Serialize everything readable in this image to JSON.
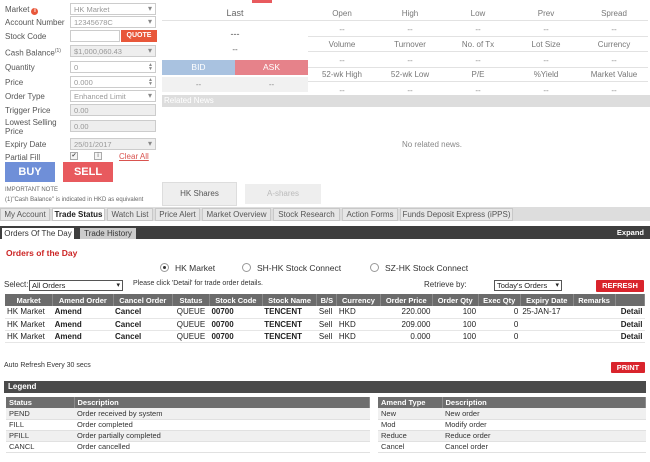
{
  "form": {
    "market_label": "Market",
    "market_value": "HK Market",
    "account_label": "Account Number",
    "account_value": "12345678C",
    "stock_code_label": "Stock Code",
    "stock_code_value": "",
    "quote_button": "QUOTE",
    "cash_label": "Cash Balance",
    "cash_sup": "(1)",
    "cash_value": "$1,000,060.43",
    "quantity_label": "Quantity",
    "quantity_value": "0",
    "price_label": "Price",
    "price_value": "0.000",
    "order_type_label": "Order Type",
    "order_type_value": "Enhanced Limit",
    "trigger_label": "Trigger Price",
    "trigger_value": "0.00",
    "lowest_label": "Lowest Selling Price",
    "lowest_value": "0.00",
    "expiry_label": "Expiry Date",
    "expiry_value": "25/01/2017",
    "partial_label": "Partial Fill",
    "partial_checked": "✔",
    "clear_all": "Clear All",
    "buy": "BUY",
    "sell": "SELL",
    "important_note": "IMPORTANT NOTE",
    "cash_note": "(1)\"Cash Balance\" is indicated in HKD as equivalent"
  },
  "quote": {
    "last_label": "Last",
    "last_value1": "---",
    "last_value2": "--",
    "bid_label": "BID",
    "ask_label": "ASK",
    "bid_value": "--",
    "ask_value": "--",
    "row1_labels": [
      "Open",
      "High",
      "Low",
      "Prev",
      "Spread"
    ],
    "row2_labels": [
      "Volume",
      "Turnover",
      "No. of Tx",
      "Lot Size",
      "Currency"
    ],
    "row3_labels": [
      "52-wk High",
      "52-wk Low",
      "P/E",
      "%Yield",
      "Market Value"
    ],
    "placeholder": "--",
    "related_news": "Related News",
    "no_news": "No related news.",
    "hk_shares_tab": "HK Shares",
    "a_shares_tab": "A-shares"
  },
  "main_tabs": [
    "My Account",
    "Trade Status",
    "Watch List",
    "Price Alert",
    "Market Overview",
    "Stock Research",
    "Action Forms",
    "Funds Deposit Express (iPPS)"
  ],
  "orders": {
    "sub_tabs": [
      "Orders Of The Day",
      "Trade History"
    ],
    "expand": "Expand",
    "title": "Orders of the Day",
    "radios": [
      "HK Market",
      "SH-HK Stock Connect",
      "SZ-HK Stock Connect"
    ],
    "select_label": "Select:",
    "select_value": "All Orders",
    "hint": "Please click 'Detail' for trade order details.",
    "retrieve_label": "Retrieve by:",
    "retrieve_value": "Today's Orders",
    "refresh": "REFRESH",
    "columns": [
      "Market",
      "Amend Order",
      "Cancel Order",
      "Status",
      "Stock Code",
      "Stock Name",
      "B/S",
      "Currency",
      "Order Price",
      "Order Qty",
      "Exec Qty",
      "Expiry Date",
      "Remarks",
      ""
    ],
    "rows": [
      [
        "HK Market",
        "Amend",
        "Cancel",
        "QUEUE",
        "00700",
        "TENCENT",
        "Sell",
        "HKD",
        "220.000",
        "100",
        "0",
        "25-JAN-17",
        "",
        "Detail"
      ],
      [
        "HK Market",
        "Amend",
        "Cancel",
        "QUEUE",
        "00700",
        "TENCENT",
        "Sell",
        "HKD",
        "209.000",
        "100",
        "0",
        "",
        "",
        "Detail"
      ],
      [
        "HK Market",
        "Amend",
        "Cancel",
        "QUEUE",
        "00700",
        "TENCENT",
        "Sell",
        "HKD",
        "0.000",
        "100",
        "0",
        "",
        "",
        "Detail"
      ]
    ],
    "auto_refresh": "Auto Refresh Every 30 secs",
    "print": "PRINT"
  },
  "legend": {
    "title": "Legend",
    "status_headers": [
      "Status",
      "Description"
    ],
    "status_rows": [
      [
        "PEND",
        "Order received by system"
      ],
      [
        "FILL",
        "Order completed"
      ],
      [
        "PFILL",
        "Order partially completed"
      ],
      [
        "CANCL",
        "Order cancelled"
      ]
    ],
    "amend_headers": [
      "Amend Type",
      "Description"
    ],
    "amend_rows": [
      [
        "New",
        "New order"
      ],
      [
        "Mod",
        "Modify order"
      ],
      [
        "Reduce",
        "Reduce order"
      ],
      [
        "Cancel",
        "Cancel order"
      ]
    ]
  },
  "colors": {
    "buy": "#6f8fd8",
    "sell": "#e85a5e",
    "accent_red": "#d9242c",
    "title_red": "#cc2424"
  }
}
